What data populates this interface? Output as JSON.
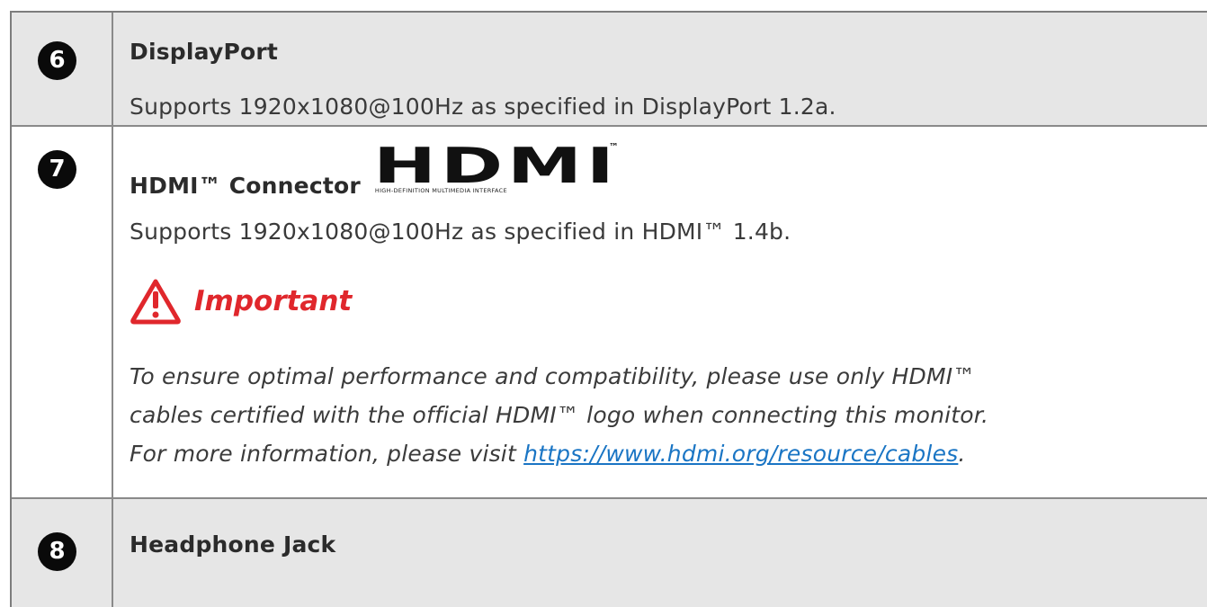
{
  "rows": [
    {
      "number": "6",
      "title": "DisplayPort",
      "description": "Supports 1920x1080@100Hz as specified in DisplayPort 1.2a."
    },
    {
      "number": "7",
      "title": "HDMI™ Connector",
      "logo": {
        "word": "HDMI",
        "tm": "™",
        "subtitle": "HIGH-DEFINITION MULTIMEDIA INTERFACE"
      },
      "description": "Supports 1920x1080@100Hz as specified in HDMI™ 1.4b.",
      "important": {
        "icon": "warning-triangle-icon",
        "label": "Important",
        "color": "#e0272c",
        "line1": "To ensure optimal performance and compatibility, please use only HDMI™",
        "line2": "cables certified with the official HDMI™ logo when connecting this monitor.",
        "line3_prefix": "For more information, please visit ",
        "link": "https://www.hdmi.org/resource/cables",
        "line3_suffix": "."
      }
    },
    {
      "number": "8",
      "title": "Headphone Jack"
    }
  ],
  "colors": {
    "row_gray": "#e6e6e6",
    "row_white": "#ffffff",
    "border": "#8a8a8a",
    "link": "#1a75c4",
    "badge": "#0a0a0a"
  }
}
